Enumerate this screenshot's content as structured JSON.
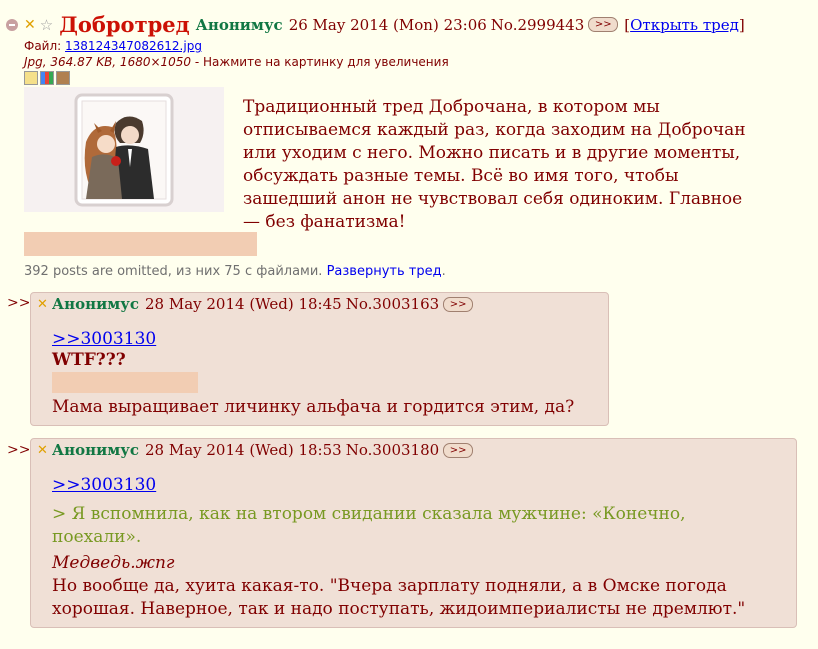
{
  "op": {
    "subject": "Добротред",
    "name": "Анонимус",
    "date": "26 May 2014 (Mon) 23:06",
    "number": "No.2999443",
    "reply_btn": ">>",
    "open_thread": "Открыть тред",
    "open_bracket_left": "[",
    "open_bracket_right": "]",
    "file_label": "Файл:",
    "file_name": "13812434708261​2.jpg",
    "file_meta": "Jpg, 364.87 KB, 1680×1050",
    "file_hint": " - Нажмите на картинку для увеличения",
    "text": "Традиционный тред Доброчана, в котором мы отписываемся каждый раз, когда заходим на Доброчан или уходим с него. Можно писать и в другие моменты, обсуждать разные темы. Всё во имя того, чтобы зашедший анон не чувствовал себя одиноким. Главное — без фанатизма!"
  },
  "omitted": {
    "text": "392 posts are omitted, из них 75 с файлами.",
    "expand_link": "Развернуть тред"
  },
  "replies": [
    {
      "arrow": ">>",
      "name": "Анонимус",
      "date": "28 May 2014 (Wed) 18:45",
      "number": "No.3003163",
      "reply_btn": ">>",
      "ref": ">>3003130",
      "line_bold": "WTF???",
      "line_text": "Мама выращивает личинку альфача и гордится этим, да?"
    },
    {
      "arrow": ">>",
      "name": "Анонимус",
      "date": "28 May 2014 (Wed) 18:53",
      "number": "No.3003180",
      "reply_btn": ">>",
      "ref": ">>3003130",
      "quote": "> Я вспомнила, как на втором свидании сказала мужчине: «Конечно, поехали».",
      "italic_line": "Медведь.жпг",
      "line_text": "Но вообще да, хуита какая-то. \"Вчера зарплату подняли, а в Омске погода хорошая. Наверное, так и надо поступать, жидоимпериалисты не дремлют.\""
    }
  ]
}
